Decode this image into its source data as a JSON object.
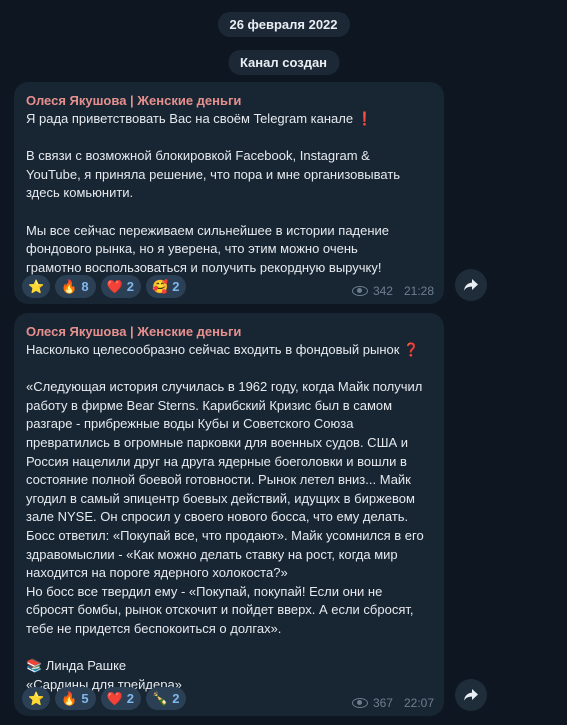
{
  "date_label": "26 февраля 2022",
  "service_label": "Канал создан",
  "colors": {
    "background": "#0e1621",
    "bubble": "#182533",
    "author": "#e6908e",
    "reaction_bg": "#2b3f55",
    "reaction_count": "#7fb7ec"
  },
  "messages": [
    {
      "author": "Олеся Якушова | Женские деньги",
      "lines": [
        "Я рада приветствовать Вас на своём Telegram канале",
        "",
        "В связи с возможной блокировкой Facebook, Instagram &",
        "YouTube, я приняла решение, что пора и мне организовывать",
        "здесь комьюнити.",
        "",
        "Мы все сейчас переживаем сильнейшее в истории падение",
        "фондового рынка, но я уверена, что этим можно очень",
        "грамотно воспользоваться и получить рекордную выручку!"
      ],
      "first_line_mark": "❗",
      "reactions": [
        {
          "emoji": "⭐",
          "count": ""
        },
        {
          "emoji": "🔥",
          "count": "8"
        },
        {
          "emoji": "❤️",
          "count": "2"
        },
        {
          "emoji": "🥰",
          "count": "2"
        }
      ],
      "views": "342",
      "time": "21:28"
    },
    {
      "author": "Олеся Якушова | Женские деньги",
      "lines": [
        "Насколько целесообразно сейчас входить в фондовый рынок",
        "",
        "«Следующая история случилась в 1962 году, когда Майк получил",
        "работу в фирме Bear Sterns. Карибский Кризис был в самом",
        "разгаре - прибрежные воды Кубы и Советского Союза",
        "превратились в огромные парковки для военных судов. США и",
        "Россия нацелили друг на друга ядерные боеголовки и вошли в",
        "состояние полной боевой готовности. Рынок летел вниз... Майк",
        "угодил в самый эпицентр боевых действий, идущих в биржевом",
        "зале NYSE. Он спросил у своего нового босса, что ему делать.",
        "Босс ответил: «Покупай все, что продают». Майк усомнился в его",
        "здравомыслии - «Как можно делать ставку на рост, когда мир",
        "находится на пороге ядерного холокоста?»",
        "Но босс все твердил ему - «Покупай, покупай! Если они не",
        "сбросят бомбы, рынок отскочит и пойдет вверх. А если сбросят,",
        "тебе не придется беспокоиться о долгах».",
        "",
        "📚 Линда Рашке",
        "«Сардины для трейдера»"
      ],
      "first_line_mark": "❓",
      "reactions": [
        {
          "emoji": "⭐",
          "count": ""
        },
        {
          "emoji": "🔥",
          "count": "5"
        },
        {
          "emoji": "❤️",
          "count": "2"
        },
        {
          "emoji": "🍾",
          "count": "2"
        }
      ],
      "views": "367",
      "time": "22:07"
    }
  ]
}
